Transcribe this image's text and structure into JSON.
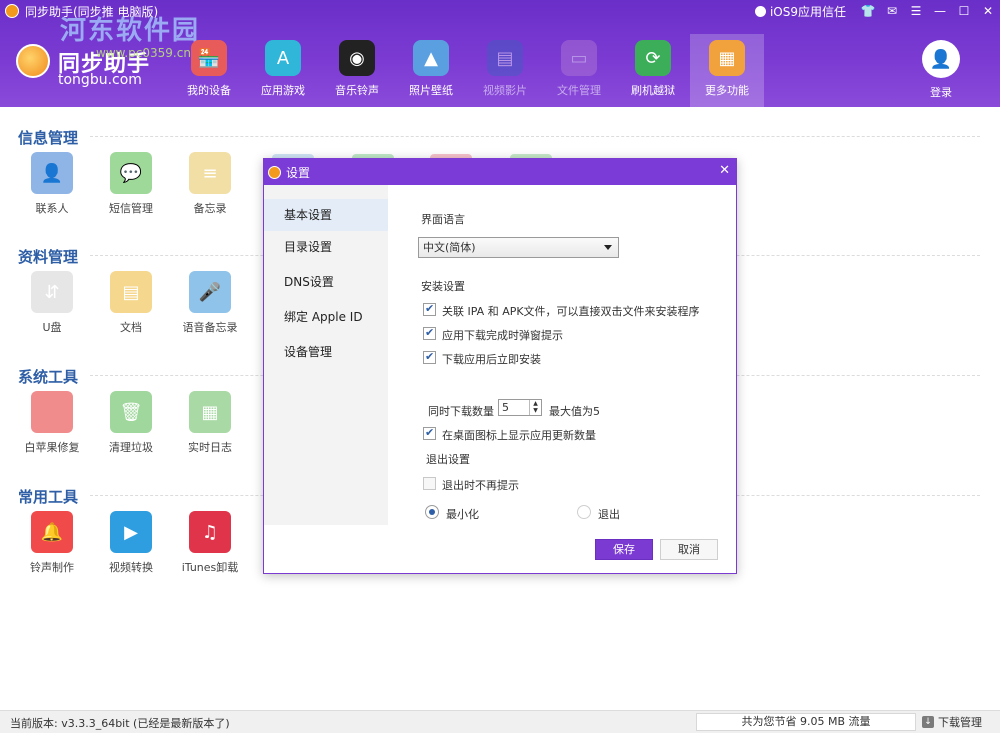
{
  "window": {
    "title": "同步助手(同步推 电脑版)",
    "trust_link": "iOS9应用信任",
    "controls": [
      "skin-icon",
      "message-icon",
      "menu-icon",
      "minimize-icon",
      "maximize-icon",
      "close-icon"
    ]
  },
  "watermark": {
    "text": "河东软件园",
    "url": "www.pc0359.cn"
  },
  "logo": {
    "name": "同步助手",
    "url": "tongbu.com"
  },
  "nav": [
    {
      "label": "我的设备",
      "icon": "store-icon",
      "color": "#e85b5b"
    },
    {
      "label": "应用游戏",
      "icon": "app-store-icon",
      "color": "#2fb6d9"
    },
    {
      "label": "音乐铃声",
      "icon": "vinyl-icon",
      "color": "#222222"
    },
    {
      "label": "照片壁纸",
      "icon": "photo-icon",
      "color": "#5aa0e0"
    },
    {
      "label": "视频影片",
      "icon": "clapper-icon",
      "color": "#3b5fbf"
    },
    {
      "label": "文件管理",
      "icon": "folder-icon",
      "color": "#b47ad6"
    },
    {
      "label": "刷机越狱",
      "icon": "refresh-icon",
      "color": "#3cae5a"
    },
    {
      "label": "更多功能",
      "icon": "grid-icon",
      "color": "#f2a23c"
    }
  ],
  "login": {
    "label": "登录"
  },
  "sections": [
    {
      "title": "信息管理",
      "tools": [
        {
          "label": "联系人",
          "icon": "contact-icon",
          "color": "#8fb4e6"
        },
        {
          "label": "短信管理",
          "icon": "chat-icon",
          "color": "#9ed99a"
        },
        {
          "label": "备忘录",
          "icon": "notes-icon",
          "color": "#f2dfa6"
        }
      ]
    },
    {
      "title": "资料管理",
      "tools": [
        {
          "label": "U盘",
          "icon": "usb-icon",
          "color": "#e6e6e6"
        },
        {
          "label": "文档",
          "icon": "document-icon",
          "color": "#f5d78e"
        },
        {
          "label": "语音备忘录",
          "icon": "microphone-icon",
          "color": "#8fc3ea"
        }
      ]
    },
    {
      "title": "系统工具",
      "tools": [
        {
          "label": "白苹果修复",
          "icon": "apple-icon",
          "color": "#f08c8c"
        },
        {
          "label": "清理垃圾",
          "icon": "trash-icon",
          "color": "#9fd79c"
        },
        {
          "label": "实时日志",
          "icon": "log-icon",
          "color": "#a9d9a4"
        }
      ]
    },
    {
      "title": "常用工具",
      "tools": [
        {
          "label": "铃声制作",
          "icon": "bell-icon",
          "color": "#f04a4a"
        },
        {
          "label": "视频转换",
          "icon": "play-icon",
          "color": "#2f9ee0"
        },
        {
          "label": "iTunes卸载",
          "icon": "itunes-icon",
          "color": "#e0344a"
        }
      ]
    }
  ],
  "status": {
    "version": "当前版本: v3.3.3_64bit  (已经是最新版本了)",
    "traffic": "共为您节省  9.05 MB 流量",
    "download": "下载管理"
  },
  "dialog": {
    "title": "设置",
    "tabs": [
      "基本设置",
      "目录设置",
      "DNS设置",
      "绑定 Apple ID",
      "设备管理"
    ],
    "language_label": "界面语言",
    "language_value": "中文(简体)",
    "install_label": "安装设置",
    "options": [
      {
        "label": "关联 IPA 和 APK文件，可以直接双击文件来安装程序",
        "checked": true
      },
      {
        "label": "应用下载完成时弹窗提示",
        "checked": true
      },
      {
        "label": "下载应用后立即安装",
        "checked": true
      },
      {
        "label": "在桌面图标上显示应用更新数量",
        "checked": true
      }
    ],
    "concurrent_label": "同时下载数量",
    "concurrent_value": "5",
    "max_label": "最大值为5",
    "exit_label": "退出设置",
    "exit_no_prompt": {
      "label": "退出时不再提示",
      "checked": false
    },
    "minimize": {
      "label": "最小化",
      "selected": true
    },
    "quit": {
      "label": "退出",
      "selected": false
    },
    "save": "保存",
    "cancel": "取消"
  }
}
